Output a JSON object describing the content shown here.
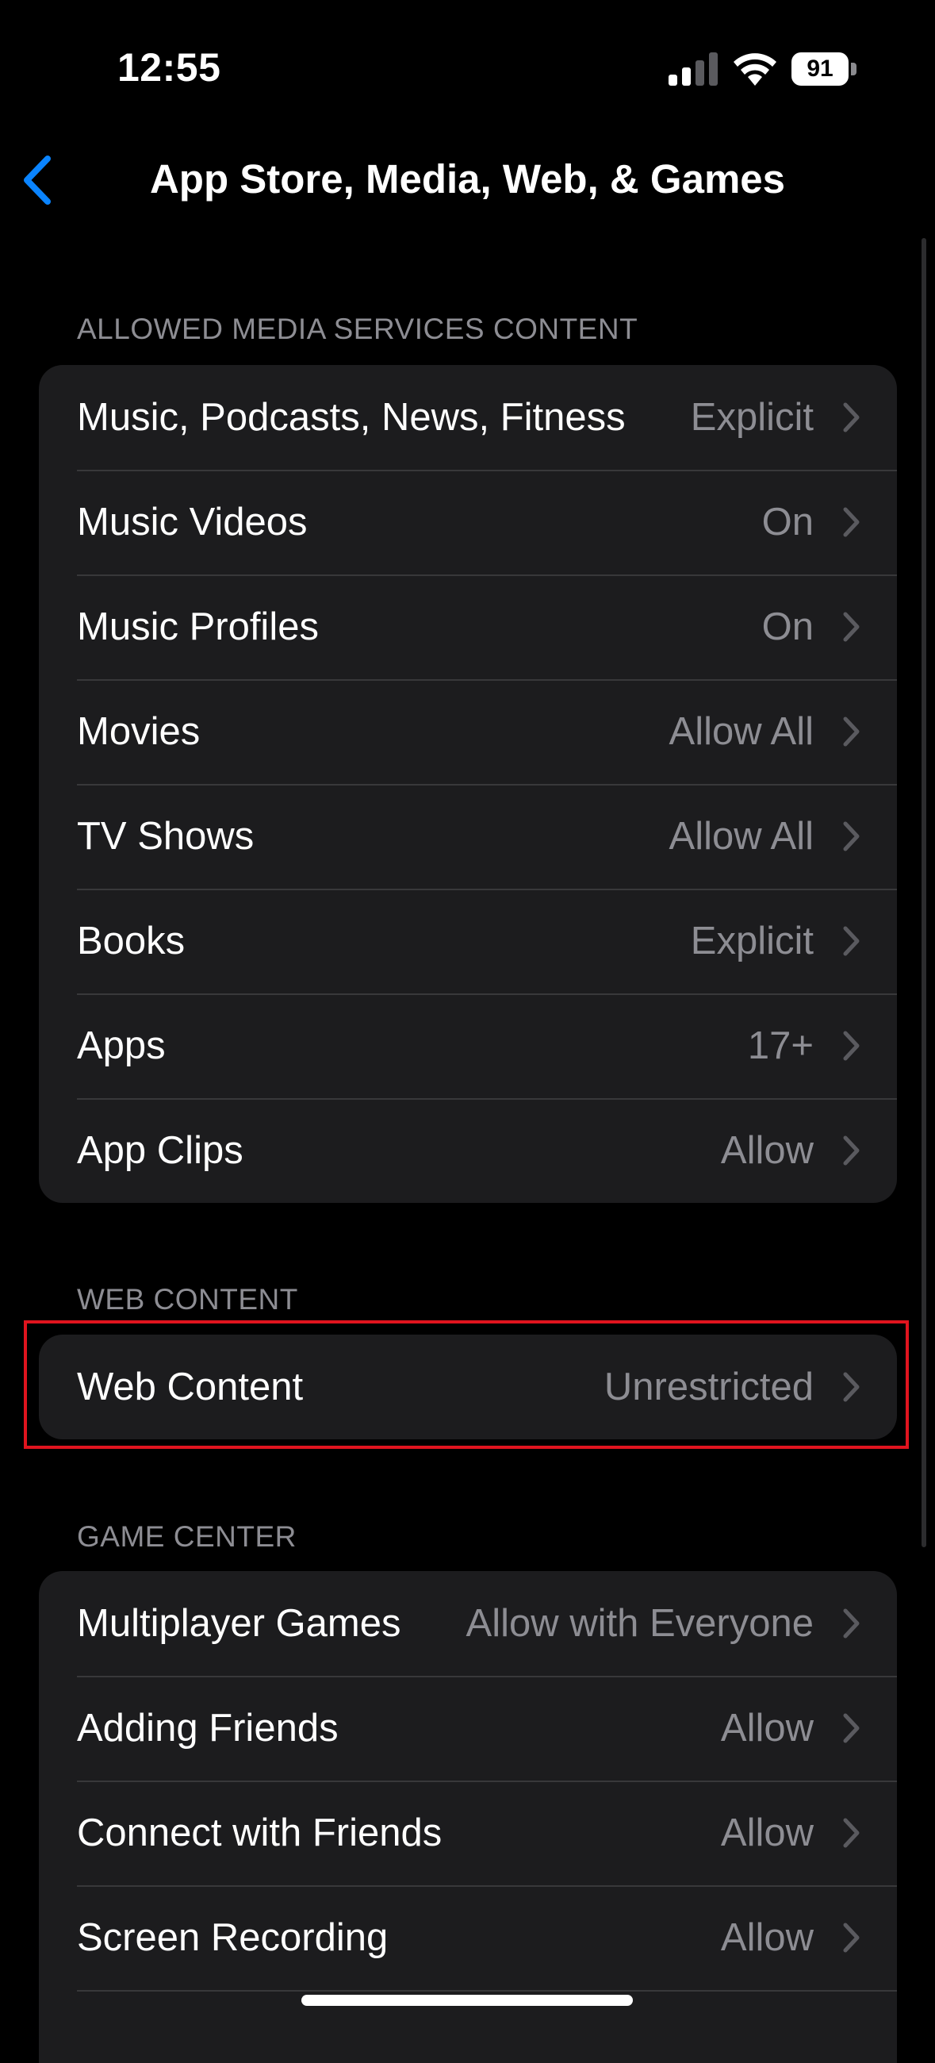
{
  "status_bar": {
    "time": "12:55",
    "battery": "91"
  },
  "nav": {
    "title": "App Store, Media, Web, & Games"
  },
  "sections": [
    {
      "header": "ALLOWED MEDIA SERVICES CONTENT",
      "rows": [
        {
          "label": "Music, Podcasts, News, Fitness",
          "value": "Explicit"
        },
        {
          "label": "Music Videos",
          "value": "On"
        },
        {
          "label": "Music Profiles",
          "value": "On"
        },
        {
          "label": "Movies",
          "value": "Allow All"
        },
        {
          "label": "TV Shows",
          "value": "Allow All"
        },
        {
          "label": "Books",
          "value": "Explicit"
        },
        {
          "label": "Apps",
          "value": "17+"
        },
        {
          "label": "App Clips",
          "value": "Allow"
        }
      ]
    },
    {
      "header": "WEB CONTENT",
      "rows": [
        {
          "label": "Web Content",
          "value": "Unrestricted"
        }
      ]
    },
    {
      "header": "GAME CENTER",
      "rows": [
        {
          "label": "Multiplayer Games",
          "value": "Allow with Everyone"
        },
        {
          "label": "Adding Friends",
          "value": "Allow"
        },
        {
          "label": "Connect with Friends",
          "value": "Allow"
        },
        {
          "label": "Screen Recording",
          "value": "Allow"
        }
      ]
    }
  ],
  "colors": {
    "background": "#000000",
    "group_background": "#1c1c1e",
    "secondary_text": "#8d8d93",
    "accent": "#0a84ff",
    "highlight": "#e0141e"
  }
}
